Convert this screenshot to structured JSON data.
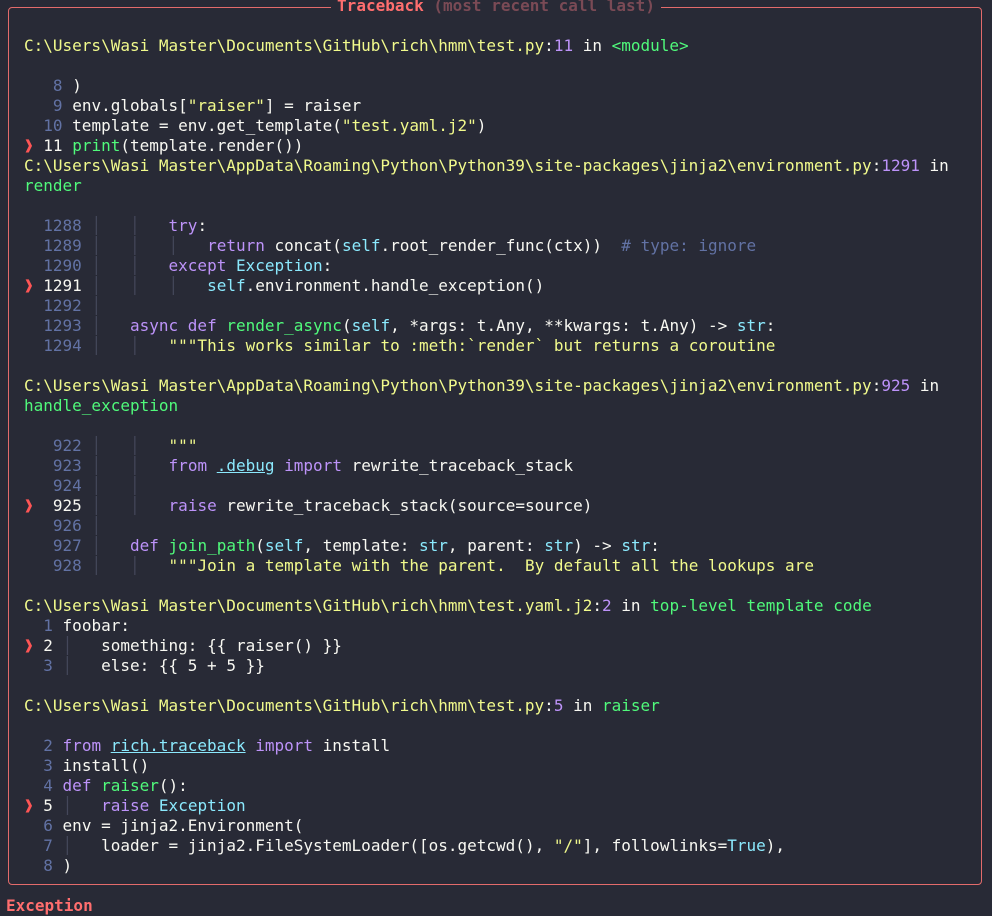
{
  "title": {
    "main": "Traceback",
    "sub": "(most recent call last)"
  },
  "frames": [
    {
      "path": "C:\\Users\\Wasi Master\\Documents\\GitHub\\rich\\hmm\\test.py",
      "lineno": "11",
      "in": "in",
      "func": "<module>",
      "lines": [
        "8 )",
        "9 env.globals[\"raiser\"] = raiser",
        "10 template = env.get_template(\"test.yaml.j2\")",
        "11 print(template.render())"
      ]
    },
    {
      "path": "C:\\Users\\Wasi Master\\AppData\\Roaming\\Python\\Python39\\site-packages\\jinja2\\environment.py",
      "lineno": "1291",
      "in": "in",
      "func": "render"
    },
    {
      "path": "C:\\Users\\Wasi Master\\AppData\\Roaming\\Python\\Python39\\site-packages\\jinja2\\environment.py",
      "lineno": "925",
      "in": "in",
      "func": "handle_exception"
    },
    {
      "path": "C:\\Users\\Wasi Master\\Documents\\GitHub\\rich\\hmm\\test.yaml.j2",
      "lineno": "2",
      "in": "in",
      "func": "top-level template code"
    },
    {
      "path": "C:\\Users\\Wasi Master\\Documents\\GitHub\\rich\\hmm\\test.py",
      "lineno": "5",
      "in": "in",
      "func": "raiser"
    }
  ],
  "code": {
    "f1": {
      "n8": "8",
      "n9": "9",
      "n10": "10",
      "n11": "11",
      "l8": ")",
      "l9a": "env.globals[",
      "l9s": "\"raiser\"",
      "l9b": "] = raiser",
      "l10a": "template = env.get_template(",
      "l10s": "\"test.yaml.j2\"",
      "l10b": ")",
      "l11a": "print",
      "l11b": "(template.render())"
    },
    "f2": {
      "n1288": "1288",
      "n1289": "1289",
      "n1290": "1290",
      "n1291": "1291",
      "n1292": "1292",
      "n1293": "1293",
      "n1294": "1294",
      "try": "try",
      "colon": ":",
      "ret": "return",
      "ret_call": " concat(",
      "self": "self",
      "ret_rest": ".root_render_func(ctx))",
      "cm": "# type: ignore",
      "except": "except",
      "exc": "Exception",
      "l1291": ".environment.handle_exception()",
      "async": "async",
      "def": "def",
      "fn": "render_async",
      "args": "(",
      "args2": ", *args: t.Any, **kwargs: t.Any) -> ",
      "str": "str",
      "doc": "\"\"\"This works similar to :meth:`render` but returns a coroutine"
    },
    "f3": {
      "n922": "922",
      "n923": "923",
      "n924": "924",
      "n925": "925",
      "n926": "926",
      "n927": "927",
      "n928": "928",
      "doc_end": "\"\"\"",
      "from": "from",
      "mod": ".debug",
      "import": "import",
      "imp": " rewrite_traceback_stack",
      "raise": "raise",
      "raise_rest": " rewrite_traceback_stack(source=source)",
      "def": "def",
      "fn": "join_path",
      "p1": "(",
      "self": "self",
      "p2": ", template: ",
      "str": "str",
      "p3": ", parent: ",
      "p4": ") -> ",
      "doc": "\"\"\"Join a template with the parent.  By default all the lookups are"
    },
    "f4": {
      "n1": "1",
      "n2": "2",
      "n3": "3",
      "l1": "foobar:",
      "l2": "something: {{ raiser() }}",
      "l3": "else: {{ 5 + 5 }}"
    },
    "f5": {
      "n2": "2",
      "n3": "3",
      "n4": "4",
      "n5": "5",
      "n6": "6",
      "n7": "7",
      "n8": "8",
      "from": "from",
      "mod": "rich.traceback",
      "import": "import",
      "imp": " install",
      "l3": "install()",
      "def": "def",
      "fn": "raiser",
      "fn_rest": "():",
      "raise": "raise",
      "exc": "Exception",
      "l6": "env = jinja2.Environment(",
      "l7a": "loader = jinja2.FileSystemLoader([os.getcwd(), ",
      "l7s": "\"/\"",
      "l7b": "], followlinks=",
      "true": "True",
      "l7c": "),",
      "l8": ")"
    }
  },
  "exception": "Exception",
  "arrow": "❱",
  "guide": "│"
}
